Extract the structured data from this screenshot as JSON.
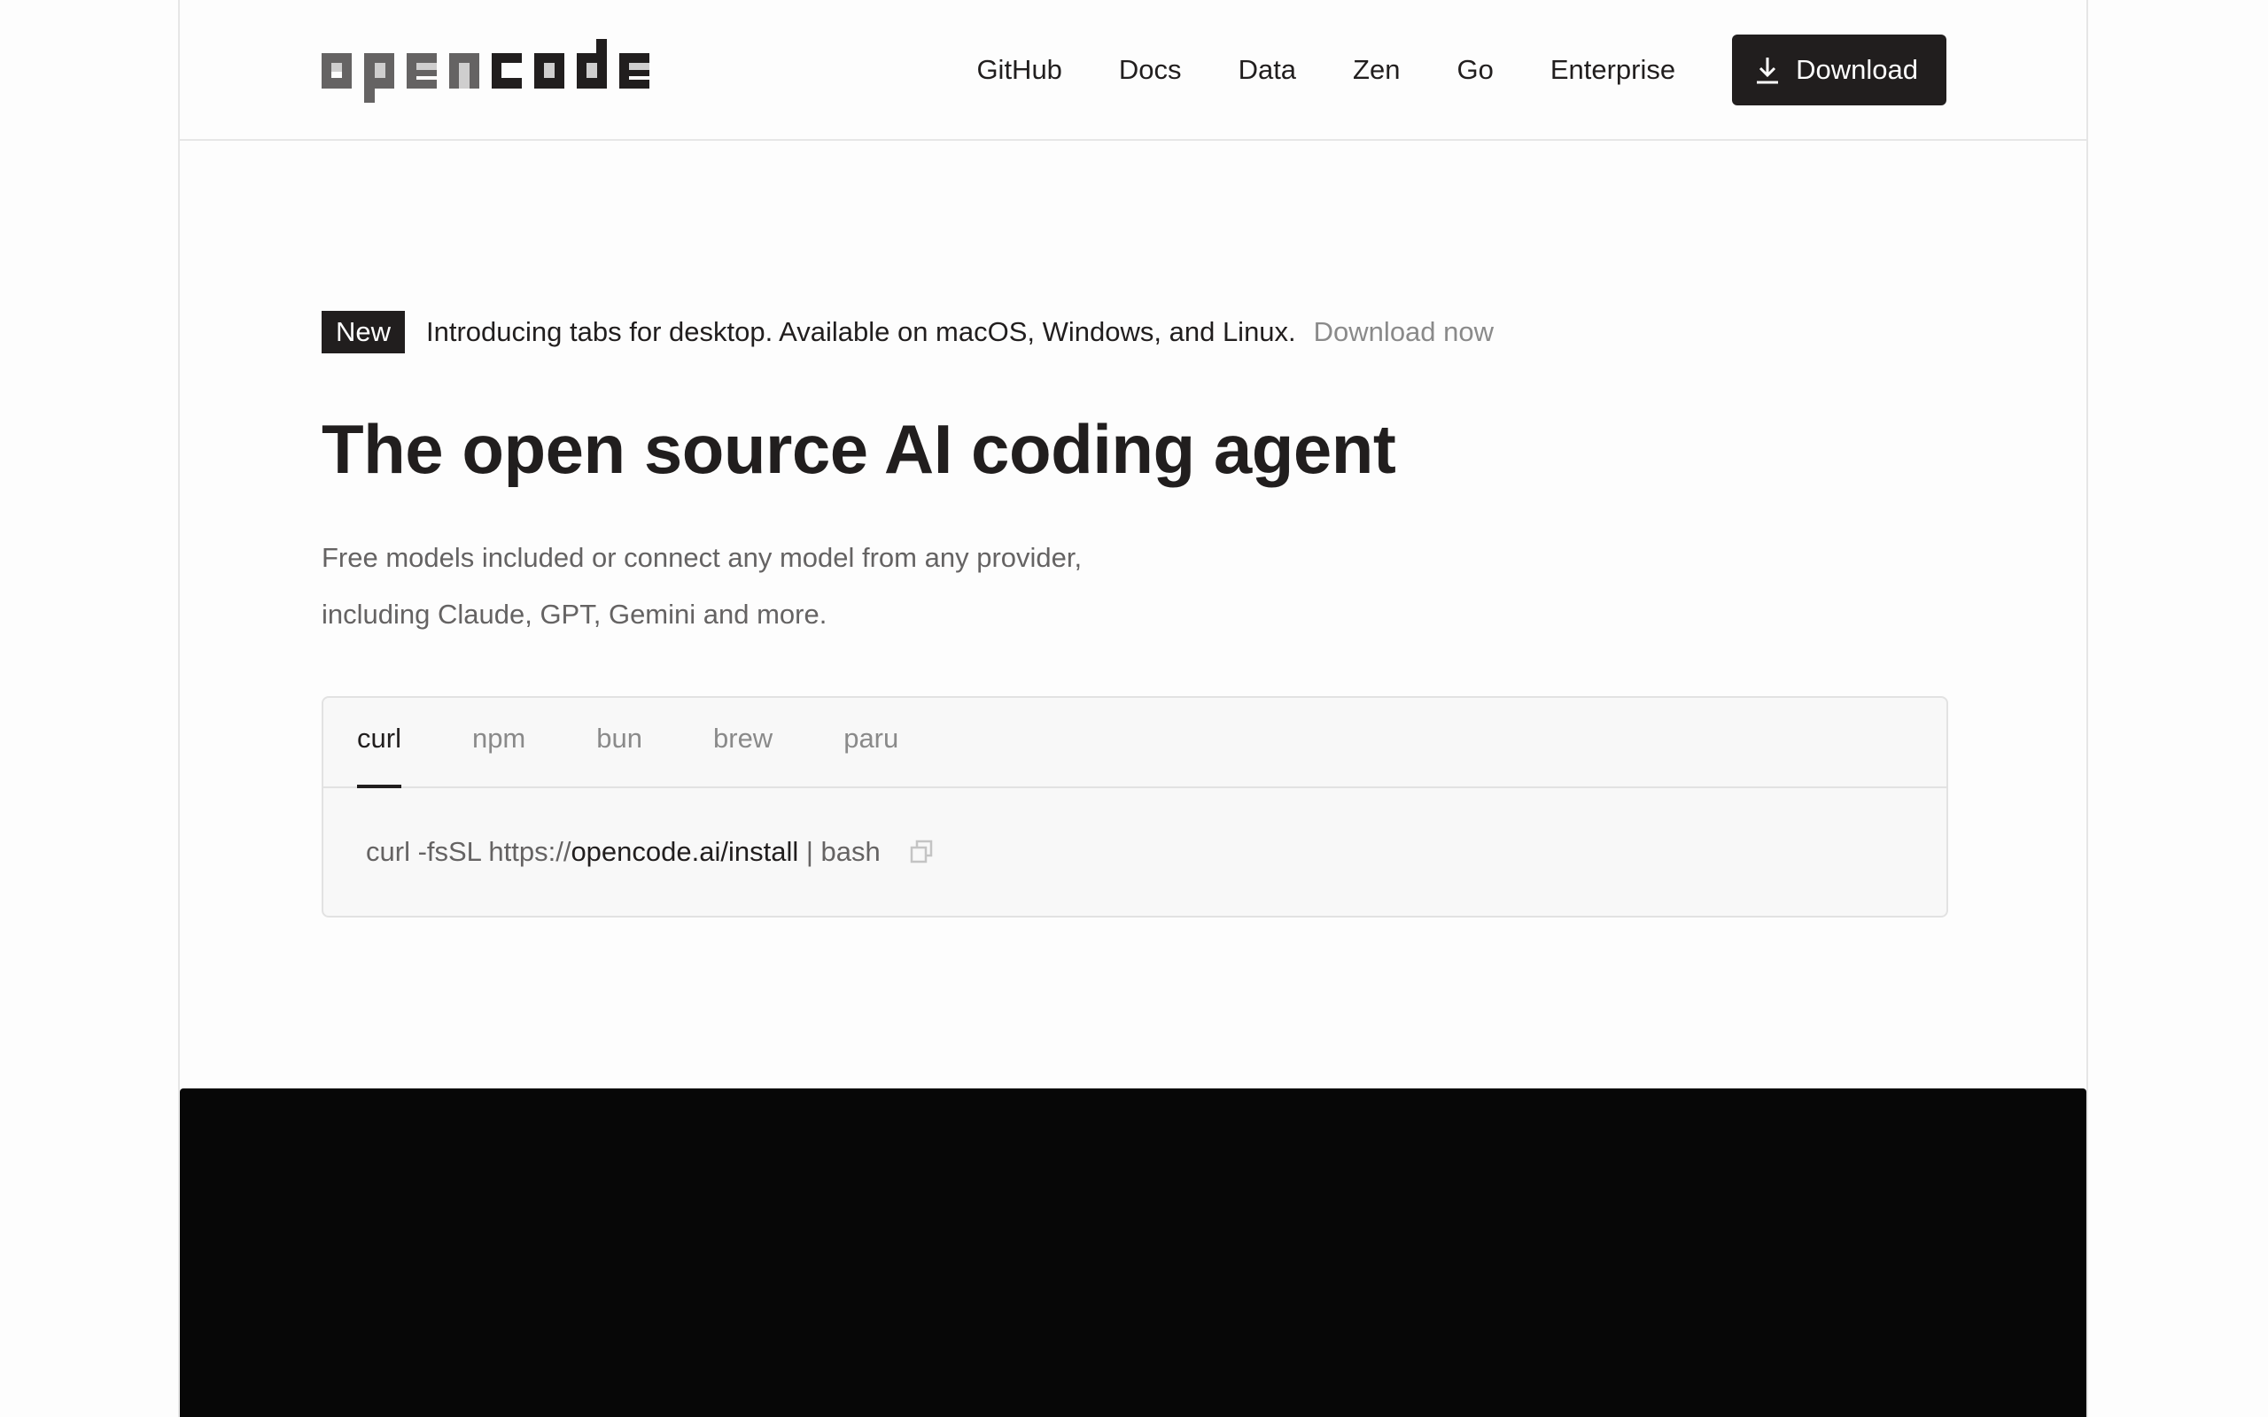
{
  "header": {
    "logo_text": "opencode",
    "nav": [
      {
        "label": "GitHub"
      },
      {
        "label": "Docs"
      },
      {
        "label": "Data"
      },
      {
        "label": "Zen"
      },
      {
        "label": "Go"
      },
      {
        "label": "Enterprise"
      }
    ],
    "download_label": "Download",
    "download_icon": "download-icon"
  },
  "announcement": {
    "badge": "New",
    "text": "Introducing tabs for desktop. Available on macOS, Windows, and Linux.",
    "link": "Download now"
  },
  "hero": {
    "title": "The open source AI coding agent",
    "subtitle_line1": "Free models included or connect any model from any provider,",
    "subtitle_line2": "including Claude, GPT, Gemini and more."
  },
  "install": {
    "tabs": [
      {
        "label": "curl",
        "active": true
      },
      {
        "label": "npm",
        "active": false
      },
      {
        "label": "bun",
        "active": false
      },
      {
        "label": "brew",
        "active": false
      },
      {
        "label": "paru",
        "active": false
      }
    ],
    "command_prefix": "curl -fsSL https://",
    "command_url": "opencode.ai/install",
    "command_suffix": " | bash",
    "copy_icon": "copy-icon"
  },
  "colors": {
    "text_primary": "#211e1e",
    "text_muted": "#656363",
    "text_link": "#8a8a8a",
    "button_bg": "#211e1e",
    "dark_panel": "#070707"
  }
}
